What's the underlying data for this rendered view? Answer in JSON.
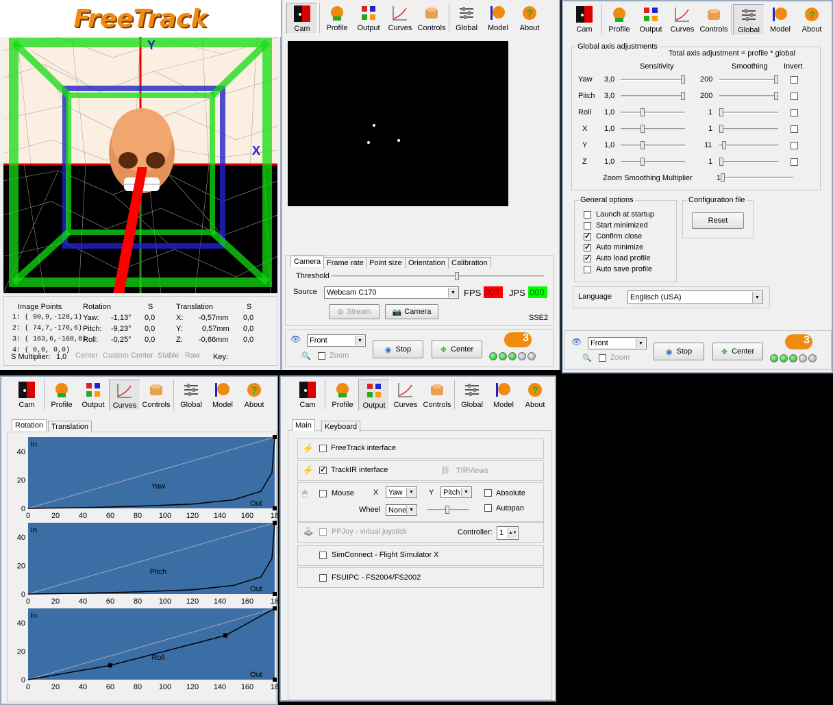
{
  "toolbar": {
    "cam": "Cam",
    "profile": "Profile",
    "output": "Output",
    "curves": "Curves",
    "controls": "Controls",
    "global": "Global",
    "model": "Model",
    "about": "About"
  },
  "logo": "FreeTrack",
  "viewport": {
    "axis_y": "Y",
    "axis_x": "X"
  },
  "status": {
    "headers": {
      "image_points": "Image Points",
      "rotation": "Rotation",
      "s1": "S",
      "translation": "Translation",
      "s2": "S"
    },
    "points": [
      "1: (  90,9,-128,1)",
      "2: (  74,7,-176,6)",
      "3: ( 163,6,-168,8)",
      "4: (    0,0,      0,0)"
    ],
    "rot_labels": [
      "Yaw:",
      "Pitch:",
      "Roll:"
    ],
    "rot_values": [
      "-1,13°",
      "-9,23°",
      "-0,25°"
    ],
    "rot_s": [
      "0,0",
      "0,0",
      "0,0"
    ],
    "trans_labels": [
      "X:",
      "Y:",
      "Z:"
    ],
    "trans_values": [
      "-0,57mm",
      "0,57mm",
      "-0,66mm"
    ],
    "trans_s": [
      "0,0",
      "0,0",
      "0,0"
    ],
    "s_multiplier_label": "S Multiplier:",
    "s_multiplier_value": "1,0",
    "center": "Center",
    "custom_center": "Custom Center",
    "stable": "Stable",
    "raw": "Raw",
    "key": "Key:"
  },
  "cam_panel": {
    "tabs": [
      "Camera",
      "Frame rate",
      "Point size",
      "Orientation",
      "Calibration"
    ],
    "threshold": "Threshold",
    "threshold_value": 0.6,
    "source_label": "Source",
    "source_value": "Webcam C170",
    "fps_label": "FPS",
    "fps_value": "007",
    "jps_label": "JPS",
    "jps_value": "000",
    "stream": "Stream",
    "camera": "Camera",
    "sse": "SSE2"
  },
  "bottom_bar": {
    "view": "Front",
    "zoom": "Zoom",
    "stop": "Stop",
    "center": "Center"
  },
  "global": {
    "group_title": "Global axis adjustments",
    "total_note": "Total axis adjustment = profile * global",
    "col_sensitivity": "Sensitivity",
    "col_smoothing": "Smoothing",
    "col_invert": "Invert",
    "axes": [
      {
        "name": "Yaw",
        "sens": "3,0",
        "sens_pos": 1.0,
        "smooth": "200",
        "smooth_pos": 1.0
      },
      {
        "name": "Pitch",
        "sens": "3,0",
        "sens_pos": 1.0,
        "smooth": "200",
        "smooth_pos": 1.0
      },
      {
        "name": "Roll",
        "sens": "1,0",
        "sens_pos": 0.33,
        "smooth": "1",
        "smooth_pos": 0.0
      },
      {
        "name": "X",
        "sens": "1,0",
        "sens_pos": 0.33,
        "smooth": "1",
        "smooth_pos": 0.0
      },
      {
        "name": "Y",
        "sens": "1,0",
        "sens_pos": 0.33,
        "smooth": "11",
        "smooth_pos": 0.05
      },
      {
        "name": "Z",
        "sens": "1,0",
        "sens_pos": 0.33,
        "smooth": "1",
        "smooth_pos": 0.0
      }
    ],
    "zoom_label": "Zoom Smoothing Multiplier",
    "zoom_value": "1",
    "general_title": "General options",
    "options": [
      {
        "label": "Launch at startup",
        "checked": false
      },
      {
        "label": "Start minimized",
        "checked": false
      },
      {
        "label": "Confirm close",
        "checked": true
      },
      {
        "label": "Auto minimize",
        "checked": true
      },
      {
        "label": "Auto load profile",
        "checked": true
      },
      {
        "label": "Auto save profile",
        "checked": false
      }
    ],
    "config_title": "Configuration file",
    "reset": "Reset",
    "language_label": "Language",
    "language_value": "Englisch (USA)"
  },
  "curves": {
    "tabs": [
      "Rotation",
      "Translation"
    ],
    "charts": [
      {
        "label": "Yaw",
        "in": "In",
        "out": "Out"
      },
      {
        "label": "Pitch",
        "in": "In",
        "out": "Out"
      },
      {
        "label": "Roll",
        "in": "In",
        "out": "Out"
      }
    ],
    "y_ticks": [
      "40",
      "20",
      "0"
    ],
    "x_ticks": [
      "0",
      "20",
      "40",
      "60",
      "80",
      "100",
      "120",
      "140",
      "160",
      "18"
    ]
  },
  "chart_data": [
    {
      "type": "line",
      "title": "Yaw",
      "xlim": [
        0,
        180
      ],
      "ylim": [
        0,
        50
      ],
      "x": [
        0,
        40,
        80,
        120,
        150,
        170,
        178,
        180
      ],
      "y": [
        0,
        0.5,
        1.5,
        3,
        6,
        12,
        25,
        50
      ]
    },
    {
      "type": "line",
      "title": "Pitch",
      "xlim": [
        0,
        180
      ],
      "ylim": [
        0,
        50
      ],
      "x": [
        0,
        40,
        80,
        120,
        150,
        170,
        178,
        180
      ],
      "y": [
        0,
        0.5,
        1.5,
        3,
        6,
        12,
        25,
        50
      ]
    },
    {
      "type": "line",
      "title": "Roll",
      "xlim": [
        0,
        180
      ],
      "ylim": [
        0,
        50
      ],
      "x": [
        0,
        60,
        120,
        144,
        180
      ],
      "y": [
        0,
        10,
        25,
        31,
        50
      ],
      "control_points": [
        [
          60,
          10
        ],
        [
          144,
          31
        ]
      ]
    }
  ],
  "output": {
    "tabs": [
      "Main",
      "Keyboard"
    ],
    "freetrack": "FreeTrack interface",
    "trackir": "TrackIR interface",
    "tirviews": "TIRViews",
    "mouse": "Mouse",
    "x_label": "X",
    "x_value": "Yaw",
    "y_label": "Y",
    "y_value": "Pitch",
    "absolute": "Absolute",
    "wheel_label": "Wheel",
    "wheel_value": "None",
    "autopan": "Autopan",
    "ppjoy": "PPJoy - virtual joystick",
    "controller_label": "Controller:",
    "controller_value": "1",
    "simconnect": "SimConnect - Flight Simulator X",
    "fsuipc": "FSUIPC - FS2004/FS2002"
  }
}
